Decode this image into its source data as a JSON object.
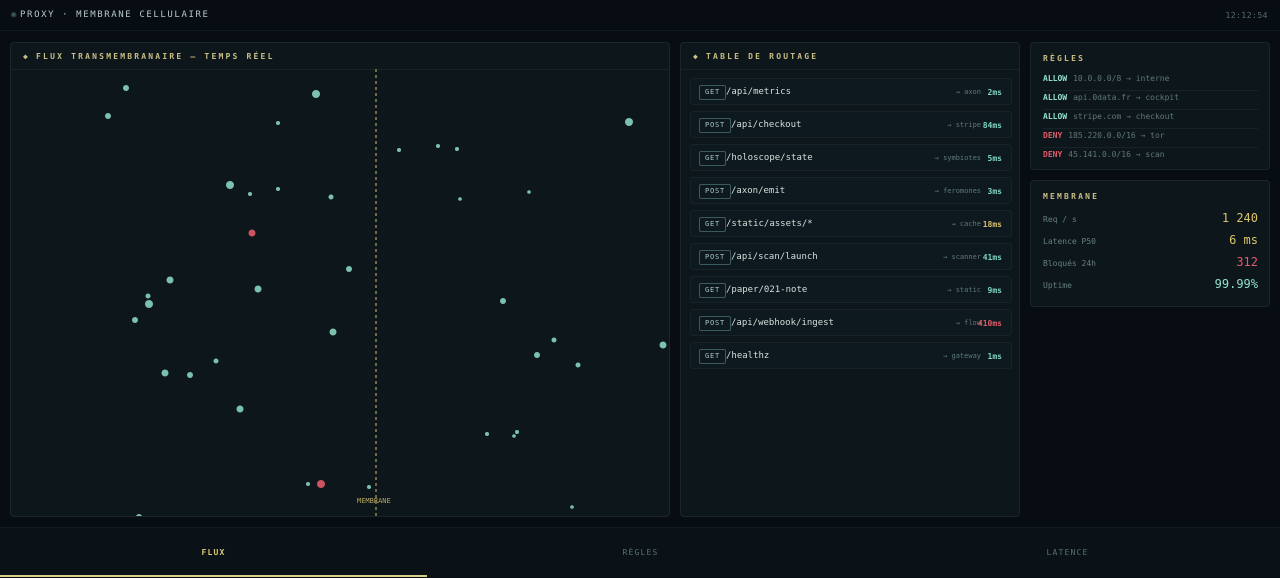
{
  "app": {
    "title": "PROXY · MEMBRANE CELLULAIRE",
    "clock": "12:12:54"
  },
  "flux": {
    "title": "FLUX TRANSMEMBRANAIRE — TEMPS RÉEL",
    "membrane_label": "MEMBRANE"
  },
  "routing": {
    "title": "TABLE DE ROUTAGE",
    "routes": [
      {
        "method": "GET",
        "path": "/api/metrics",
        "target": "→ axon",
        "latency": "2ms",
        "status": "ok"
      },
      {
        "method": "POST",
        "path": "/api/checkout",
        "target": "→ stripe",
        "latency": "84ms",
        "status": "ok"
      },
      {
        "method": "GET",
        "path": "/holoscope/state",
        "target": "→ symbiotes",
        "latency": "5ms",
        "status": "ok"
      },
      {
        "method": "POST",
        "path": "/axon/emit",
        "target": "→ feromones",
        "latency": "3ms",
        "status": "ok"
      },
      {
        "method": "GET",
        "path": "/static/assets/*",
        "target": "→ cache",
        "latency": "18ms",
        "status": "warn"
      },
      {
        "method": "POST",
        "path": "/api/scan/launch",
        "target": "→ scanner",
        "latency": "41ms",
        "status": "ok"
      },
      {
        "method": "GET",
        "path": "/paper/021-note",
        "target": "→ static",
        "latency": "9ms",
        "status": "ok"
      },
      {
        "method": "POST",
        "path": "/api/webhook/ingest",
        "target": "→ flow",
        "latency": "410ms",
        "status": "bad"
      },
      {
        "method": "GET",
        "path": "/healthz",
        "target": "→ gateway",
        "latency": "1ms",
        "status": "ok"
      }
    ]
  },
  "rules": {
    "title": "RÈGLES",
    "items": [
      {
        "action": "ALLOW",
        "detail": "10.0.0.0/8 → interne"
      },
      {
        "action": "ALLOW",
        "detail": "api.0data.fr → cockpit"
      },
      {
        "action": "ALLOW",
        "detail": "stripe.com → checkout"
      },
      {
        "action": "DENY",
        "detail": "185.220.0.0/16 → tor"
      },
      {
        "action": "DENY",
        "detail": "45.141.0.0/16 → scan"
      }
    ]
  },
  "membrane": {
    "title": "MEMBRANE",
    "stats": [
      {
        "label": "Req / s",
        "value": "1 240",
        "color": "#d9c36a"
      },
      {
        "label": "Latence P50",
        "value": "6 ms",
        "color": "#d9c36a"
      },
      {
        "label": "Bloqués 24h",
        "value": "312",
        "color": "#e05b6a"
      },
      {
        "label": "Uptime",
        "value": "99.99%",
        "color": "#8fe0c8"
      }
    ]
  },
  "tabs": [
    {
      "label": "FLUX",
      "active": true
    },
    {
      "label": "RÈGLES",
      "active": false
    },
    {
      "label": "LATENCE",
      "active": false
    }
  ],
  "colors": {
    "accent": "#c9be83",
    "particle": "#8fe0c8",
    "blocked": "#e05b6a",
    "membrane": "#b3a560"
  }
}
